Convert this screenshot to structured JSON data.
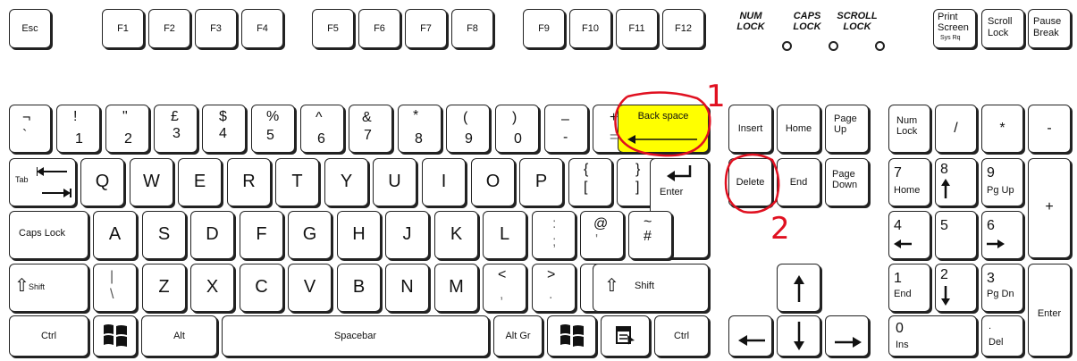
{
  "function_row": {
    "esc": "Esc",
    "f": [
      "F1",
      "F2",
      "F3",
      "F4",
      "F5",
      "F6",
      "F7",
      "F8",
      "F9",
      "F10",
      "F11",
      "F12"
    ]
  },
  "lock_indicators": [
    {
      "line1": "NUM",
      "line2": "LOCK"
    },
    {
      "line1": "CAPS",
      "line2": "LOCK"
    },
    {
      "line1": "SCROLL",
      "line2": "LOCK"
    }
  ],
  "system_keys": {
    "print_l1": "Print",
    "print_l2": "Screen",
    "print_sub": "Sys Rq",
    "scroll_l1": "Scroll",
    "scroll_l2": "Lock",
    "pause_l1": "Pause",
    "pause_l2": "Break"
  },
  "number_row": [
    {
      "top": "¬",
      "bottom": "`"
    },
    {
      "top": "!",
      "bottom": "1"
    },
    {
      "top": "\"",
      "bottom": "2"
    },
    {
      "top": "£",
      "bottom": "3"
    },
    {
      "top": "$",
      "bottom": "4"
    },
    {
      "top": "%",
      "bottom": "5"
    },
    {
      "top": "^",
      "bottom": "6"
    },
    {
      "top": "&",
      "bottom": "7"
    },
    {
      "top": "*",
      "bottom": "8"
    },
    {
      "top": "(",
      "bottom": "9"
    },
    {
      "top": ")",
      "bottom": "0"
    },
    {
      "top": "–",
      "bottom": "-"
    },
    {
      "top": "+",
      "bottom": "="
    }
  ],
  "backspace": "Back space",
  "tab": "Tab",
  "qwerty": [
    "Q",
    "W",
    "E",
    "R",
    "T",
    "Y",
    "U",
    "I",
    "O",
    "P"
  ],
  "brackets": [
    {
      "top": "{",
      "bottom": "["
    },
    {
      "top": "}",
      "bottom": "]"
    }
  ],
  "enter": "Enter",
  "caps_lock": "Caps Lock",
  "asdf": [
    "A",
    "S",
    "D",
    "F",
    "G",
    "H",
    "J",
    "K",
    "L"
  ],
  "home_row_symbols": [
    {
      "top": ":",
      "bottom": ";"
    },
    {
      "top": "@",
      "bottom": "'"
    },
    {
      "top": "~",
      "bottom": "#"
    }
  ],
  "shift": "Shift",
  "left_shift": "Shift",
  "backslash": {
    "top": "|",
    "bottom": "\\"
  },
  "zxcv": [
    "Z",
    "X",
    "C",
    "V",
    "B",
    "N",
    "M"
  ],
  "bottom_row_symbols": [
    {
      "top": "<",
      "bottom": ","
    },
    {
      "top": ">",
      "bottom": "."
    },
    {
      "top": "?",
      "bottom": "/"
    }
  ],
  "ctrl": "Ctrl",
  "alt": "Alt",
  "spacebar": "Spacebar",
  "alt_gr": "Alt Gr",
  "nav": {
    "insert": "Insert",
    "home": "Home",
    "page_up_l1": "Page",
    "page_up_l2": "Up",
    "delete": "Delete",
    "end": "End",
    "page_down_l1": "Page",
    "page_down_l2": "Down"
  },
  "numpad": {
    "num_l1": "Num",
    "num_l2": "Lock",
    "slash": "/",
    "star": "*",
    "minus": "-",
    "plus": "+",
    "n7": "7",
    "n7_sub": "Home",
    "n8": "8",
    "n9": "9",
    "n9_sub": "Pg Up",
    "n4": "4",
    "n5": "5",
    "n6": "6",
    "n1": "1",
    "n1_sub": "End",
    "n2": "2",
    "n3": "3",
    "n3_sub": "Pg Dn",
    "n0": "0",
    "n0_sub": "Ins",
    "dot": ".",
    "dot_sub": "Del",
    "enter": "Enter"
  },
  "annotations": {
    "one": "1",
    "two": "2"
  },
  "highlight_color": "#ffff00",
  "annotation_color": "#e01020"
}
